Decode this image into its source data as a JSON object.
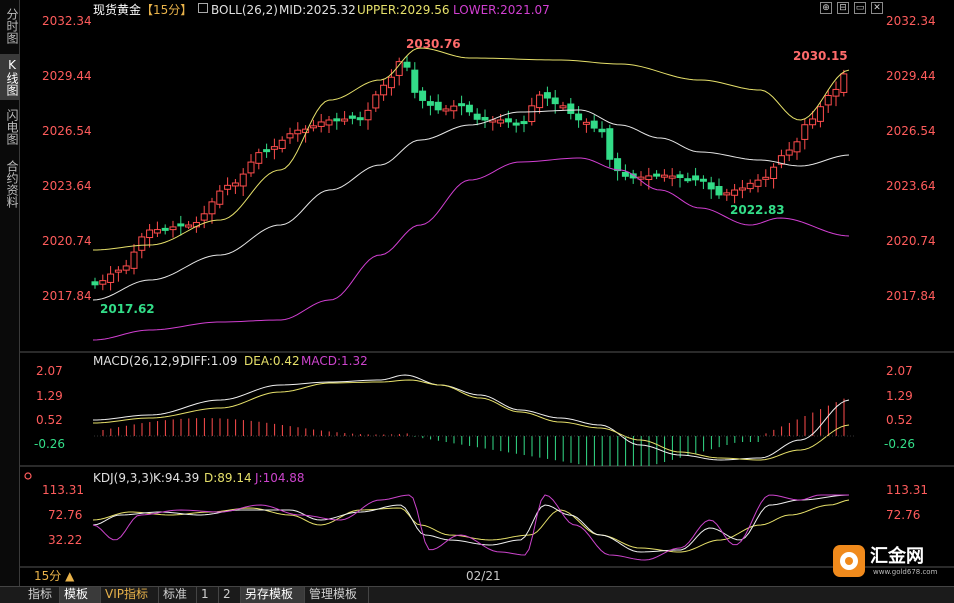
{
  "nav": {
    "items": [
      {
        "label": "分时图",
        "active": false
      },
      {
        "label": "K线图",
        "active": true
      },
      {
        "label": "闪电图",
        "active": false
      },
      {
        "label": "合约资料",
        "active": false
      }
    ]
  },
  "header": {
    "symbol": "现货黄金",
    "period": "【15分】",
    "boll_label": "BOLL(26,2)",
    "mid": "MID:2025.32",
    "upper": "UPPER:2029.56",
    "lower": "LOWER:2021.07"
  },
  "window_buttons": [
    "⊕",
    "⊟",
    "▭",
    "✕"
  ],
  "price_axis": {
    "ticks": [
      "2032.34",
      "2029.44",
      "2026.54",
      "2023.64",
      "2020.74",
      "2017.84"
    ]
  },
  "annotations": {
    "high": "2030.76",
    "recent_high": "2030.15",
    "low": "2017.62",
    "recent_low": "2022.83"
  },
  "macd": {
    "label": "MACD(26,12,9)",
    "diff": "DIFF:1.09",
    "dea": "DEA:0.42",
    "macd": "MACD:1.32",
    "ticks": [
      "2.07",
      "1.29",
      "0.52",
      "-0.26"
    ]
  },
  "kdj": {
    "label": "KDJ(9,3,3)",
    "k": "K:94.39",
    "d": "D:89.14",
    "j": "J:104.88",
    "ticks": [
      "113.31",
      "72.76",
      "32.22"
    ]
  },
  "x_axis": {
    "date_label": "02/21"
  },
  "period_selector": {
    "label": "15分 ▲"
  },
  "tabs": [
    {
      "label": "指标",
      "active": false,
      "vip": false
    },
    {
      "label": "模板",
      "active": true,
      "vip": false
    },
    {
      "label": "VIP指标",
      "active": false,
      "vip": true
    },
    {
      "label": "标准",
      "active": false,
      "vip": false
    },
    {
      "label": "1",
      "active": false,
      "vip": false
    },
    {
      "label": "2",
      "active": false,
      "vip": false
    },
    {
      "label": "另存模板",
      "active": true,
      "vip": false
    },
    {
      "label": "管理模板",
      "active": false,
      "vip": false
    }
  ],
  "logo": {
    "name": "汇金网",
    "url_text": "www.gold678.com"
  },
  "colors": {
    "up": "#ff4d4d",
    "down": "#33dd88",
    "mid": "#e6e6e6",
    "upper": "#e6e06a",
    "lower": "#d23fd2",
    "axis_text": "#ff5c5c",
    "macd_diff": "#f0f0f0",
    "macd_dea": "#e6e06a",
    "macd_text": "#cc44cc",
    "kdj_j": "#cc44cc"
  }
}
